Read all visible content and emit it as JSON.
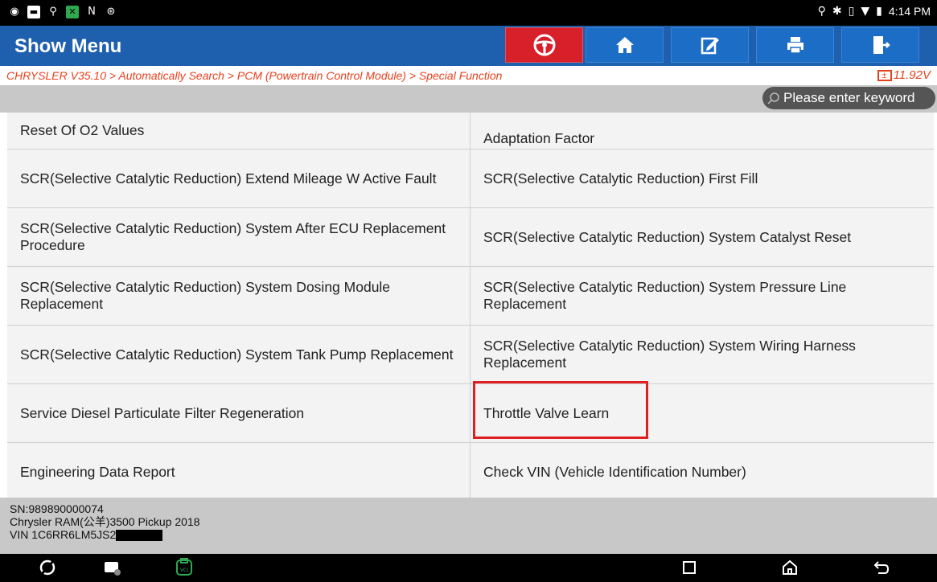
{
  "status_bar": {
    "time": "4:14 PM"
  },
  "header": {
    "title": "Show Menu"
  },
  "breadcrumb": "CHRYSLER V35.10 > Automatically Search > PCM (Powertrain Control Module) > Special Function",
  "voltage": "11.92V",
  "search": {
    "placeholder": "Please enter keyword"
  },
  "menu": {
    "rows": [
      [
        "Reset Of O2 Values",
        "Adaptation Factor"
      ],
      [
        "SCR(Selective Catalytic Reduction) Extend Mileage W Active Fault",
        "SCR(Selective Catalytic Reduction) First Fill"
      ],
      [
        "SCR(Selective Catalytic Reduction) System After ECU Replacement Procedure",
        "SCR(Selective Catalytic Reduction) System Catalyst Reset"
      ],
      [
        "SCR(Selective Catalytic Reduction) System Dosing Module Replacement",
        "SCR(Selective Catalytic Reduction) System Pressure Line Replacement"
      ],
      [
        "SCR(Selective Catalytic Reduction) System Tank Pump Replacement",
        "SCR(Selective Catalytic Reduction) System Wiring Harness Replacement"
      ],
      [
        "Service Diesel Particulate Filter Regeneration",
        "Throttle Valve Learn"
      ],
      [
        "Engineering Data Report",
        "Check VIN (Vehicle Identification Number)"
      ]
    ]
  },
  "vehicle": {
    "sn": "SN:989890000074",
    "model": "Chrysler RAM(公羊)3500 Pickup 2018",
    "vin": "VIN 1C6RR6LM5JS2"
  },
  "colors": {
    "title_bar": "#1e5fae",
    "breadcrumb": "#e8401c",
    "highlight": "#e02020"
  }
}
